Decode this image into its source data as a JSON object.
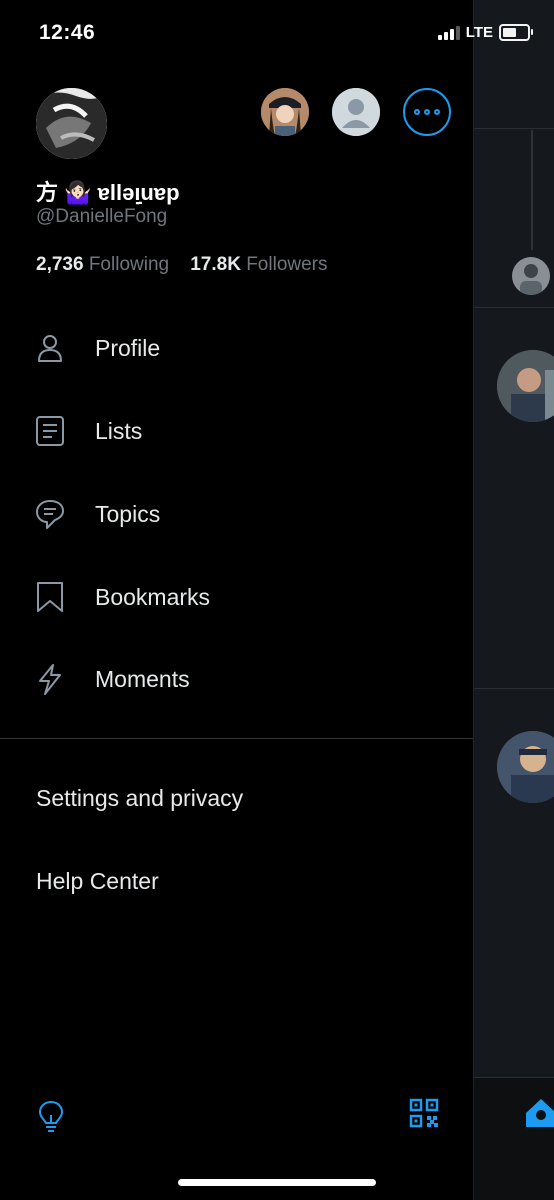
{
  "status_bar": {
    "time": "12:46",
    "network": "LTE",
    "signal_bars": 3,
    "battery_level": 0.7
  },
  "profile": {
    "display_name": "方 🤷🏻‍♀️ ɐllǝᴉ̣uɐp",
    "handle": "@DanielleFong",
    "following_count": "2,736",
    "following_label": "Following",
    "followers_count": "17.8K",
    "followers_label": "Followers"
  },
  "menu": [
    {
      "label": "Profile",
      "icon": "person-icon"
    },
    {
      "label": "Lists",
      "icon": "list-icon"
    },
    {
      "label": "Topics",
      "icon": "topics-icon"
    },
    {
      "label": "Bookmarks",
      "icon": "bookmark-icon"
    },
    {
      "label": "Moments",
      "icon": "lightning-icon"
    }
  ],
  "secondary_menu": [
    {
      "label": "Settings and privacy"
    },
    {
      "label": "Help Center"
    }
  ],
  "colors": {
    "accent": "#1d9bf0",
    "background": "#000000",
    "text": "#e7e9ea",
    "muted": "#71767b"
  }
}
